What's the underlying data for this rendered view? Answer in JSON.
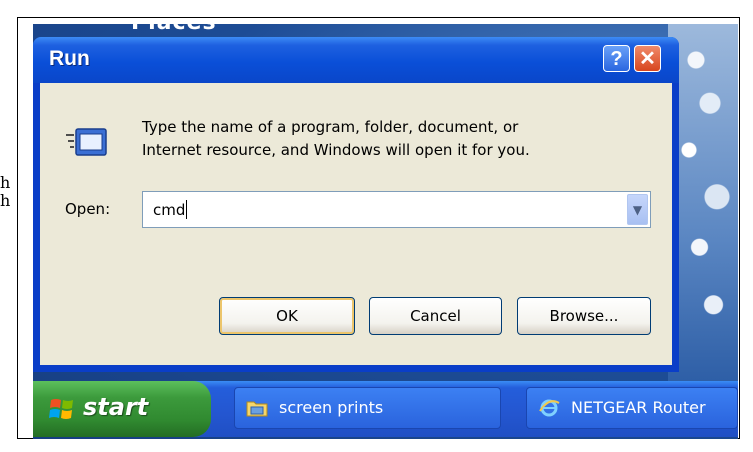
{
  "page": {
    "side_text": [
      "h",
      "h"
    ]
  },
  "desktop": {
    "title_fragment": "Places"
  },
  "dialog": {
    "title": "Run",
    "help_icon": "help-icon",
    "close_icon": "close-icon",
    "help_label": "?",
    "close_label": "✕",
    "description_line1": "Type the name of a program, folder, document, or",
    "description_line2": "Internet resource, and Windows will open it for you.",
    "open_label": "Open:",
    "open_value": "cmd",
    "dropdown_icon": "chevron-down-icon",
    "buttons": {
      "ok": "OK",
      "cancel": "Cancel",
      "browse": "Browse..."
    }
  },
  "taskbar": {
    "start_label": "start",
    "items": [
      {
        "label": "screen prints",
        "icon": "folder-icon"
      },
      {
        "label": "NETGEAR Router",
        "icon": "internet-explorer-icon"
      }
    ]
  },
  "colors": {
    "title_bar": "#0a4fd8",
    "dialog_body": "#ece9d8",
    "start_button": "#3c9a3c",
    "taskbar": "#2456d0"
  }
}
